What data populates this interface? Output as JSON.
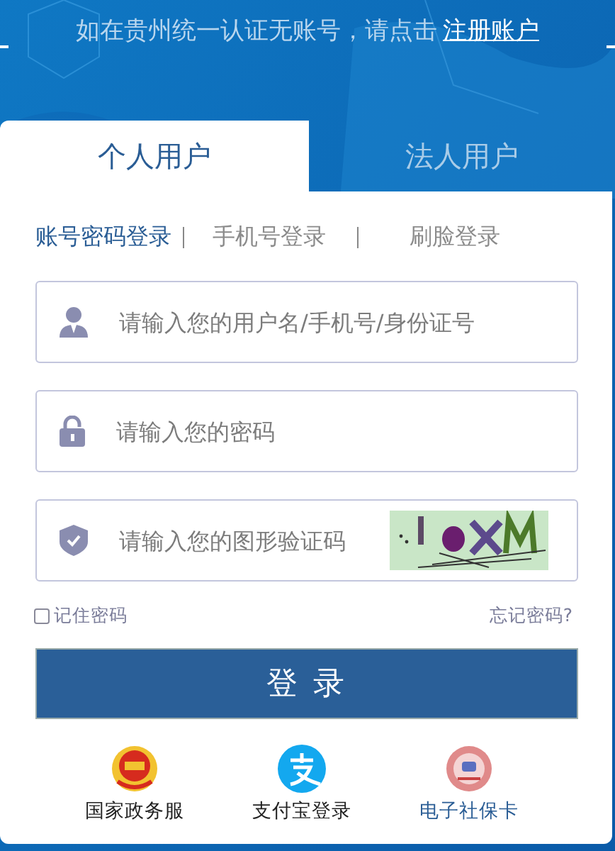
{
  "banner": {
    "text": "如在贵州统一认证无账号，请点击",
    "link": "注册账户"
  },
  "tabs": [
    {
      "label": "个人用户",
      "selected": true
    },
    {
      "label": "法人用户",
      "selected": false
    }
  ],
  "methods": [
    {
      "label": "账号密码登录",
      "selected": true
    },
    {
      "label": "手机号登录",
      "selected": false
    },
    {
      "label": "刷脸登录",
      "selected": false
    }
  ],
  "fields": [
    {
      "kind": "user",
      "placeholder": "请输入您的用户名/手机号/身份证号"
    },
    {
      "kind": "password",
      "placeholder": "请输入您的密码"
    },
    {
      "kind": "captcha",
      "placeholder": "请输入您的图形验证码"
    }
  ],
  "remember": {
    "label": "记住密码",
    "checked": false
  },
  "forgot": "忘记密码?",
  "login_button": "登 录",
  "alt_logins": [
    {
      "kind": "emblem",
      "label": "国家政务服"
    },
    {
      "kind": "alipay",
      "label": "支付宝登录"
    },
    {
      "kind": "social",
      "label": "电子社保卡"
    }
  ]
}
